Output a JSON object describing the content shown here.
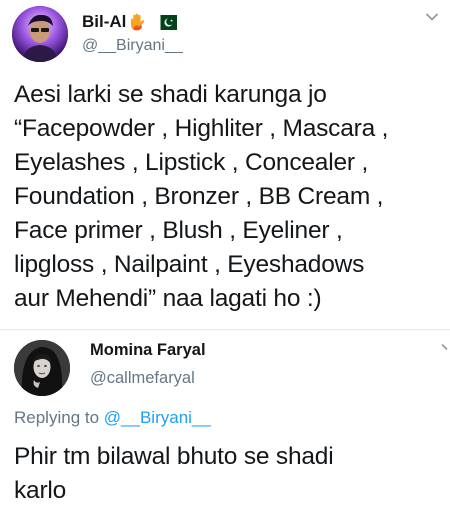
{
  "tweet": {
    "author_name": "Bil-Al",
    "author_handle": "@__Biryani__",
    "author_emoji_icons": [
      "raised-hand-fire-icon",
      "pakistan-flag-icon"
    ],
    "text": "Aesi larki se shadi karunga jo\n“Facepowder , Highliter , Mascara ,\nEyelashes , Lipstick , Concealer ,\nFoundation , Bronzer , BB Cream ,\nFace primer , Blush , Eyeliner ,\nlipgloss , Nailpaint , Eyeshadows\naur Mehendi” naa lagati ho :)"
  },
  "reply": {
    "author_name": "Momina Faryal",
    "author_handle": "@callmefaryal",
    "replying_label": "Replying to",
    "replying_to_handle": "@__Biryani__",
    "text": "Phir tm bilawal bhuto se shadi\nkarlo"
  },
  "colors": {
    "primary_text": "#14171a",
    "secondary_text": "#657786",
    "link": "#1da1f2",
    "divider": "#e1e8ed"
  }
}
